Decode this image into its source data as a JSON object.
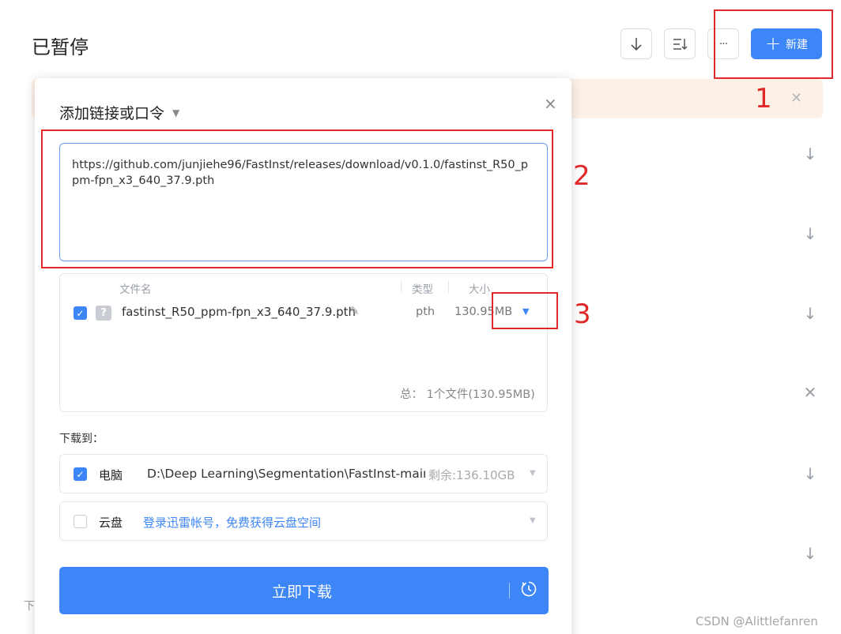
{
  "header": {
    "title": "已暂停",
    "download_icon": "arrow-down-icon",
    "sort_icon": "sort-list-icon",
    "more_label": "···",
    "new_label": "新建"
  },
  "dialog": {
    "title": "添加链接或口令",
    "close_label": "×",
    "url_text": "https://github.com/junjiehe96/FastInst/releases/download/v0.1.0/fastinst_R50_ppm-fpn_x3_640_37.9.pth",
    "file_table": {
      "headers": [
        "文件名",
        "类型",
        "大小"
      ],
      "rows": [
        {
          "checked": true,
          "name": "fastinst_R50_ppm-fpn_x3_640_37.9.pth",
          "type": "pth",
          "size": "130.95MB"
        }
      ],
      "total_label": "总：",
      "total_value": "1个文件(130.95MB)"
    },
    "download_to_label": "下载到：",
    "destinations": [
      {
        "checked": true,
        "name": "电脑",
        "path": "D:\\Deep Learning\\Segmentation\\FastInst-main",
        "free": "剩余:136.10GB"
      },
      {
        "checked": false,
        "name": "云盘",
        "link": "登录迅雷帐号，免费获得云盘空间"
      }
    ],
    "download_button": "立即下载"
  },
  "annotations": [
    "1",
    "2",
    "3"
  ],
  "footer": {
    "partial_text": "下",
    "watermark": "CSDN @Alittlefanren"
  },
  "colors": {
    "accent": "#3d86f7",
    "annotation_red": "#e02828",
    "warning_bg": "#fdf1e7"
  }
}
